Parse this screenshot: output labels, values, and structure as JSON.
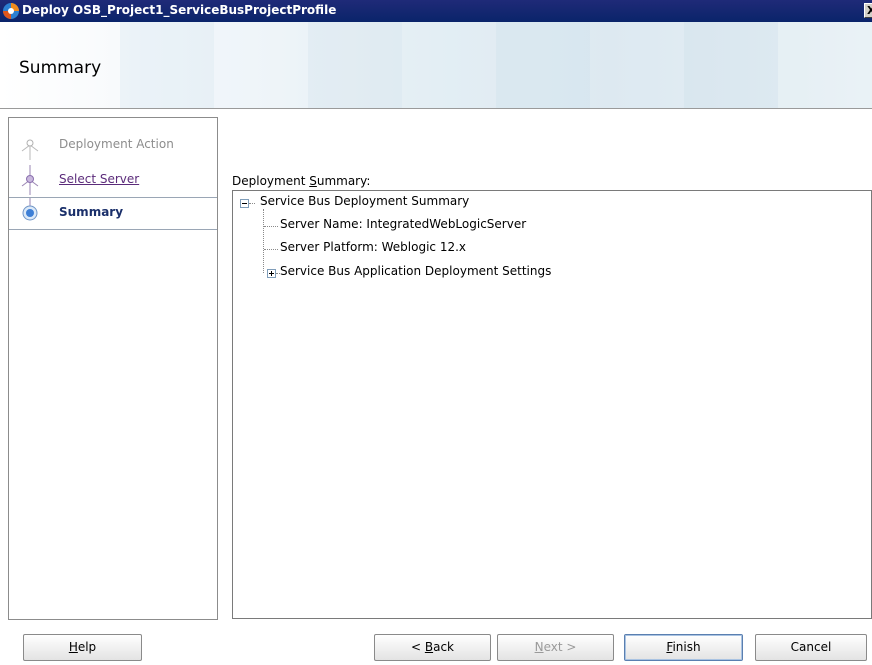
{
  "window": {
    "title": "Deploy OSB_Project1_ServiceBusProjectProfile",
    "close_glyph": "X"
  },
  "header": {
    "title": "Summary"
  },
  "sidebar": {
    "items": [
      {
        "label": "Deployment Action",
        "state": "disabled",
        "icon": "step-node-icon"
      },
      {
        "label": "Select Server",
        "state": "link",
        "icon": "step-node-icon"
      },
      {
        "label": "Summary",
        "state": "current",
        "icon": "current-step-icon"
      }
    ]
  },
  "main": {
    "summary_label_prefix": "Deployment ",
    "summary_label_mnemonic": "S",
    "summary_label_suffix": "ummary:",
    "tree": {
      "root": "Service Bus Deployment Summary",
      "children": [
        "Server Name: IntegratedWebLogicServer",
        "Server Platform: Weblogic 12.x",
        "Service Bus Application Deployment Settings"
      ]
    }
  },
  "buttons": {
    "help": {
      "mnemonic": "H",
      "rest": "elp"
    },
    "back": {
      "prefix": "< ",
      "mnemonic": "B",
      "rest": "ack"
    },
    "next": {
      "mnemonic": "N",
      "rest": "ext >"
    },
    "finish": {
      "mnemonic": "F",
      "rest": "inish"
    },
    "cancel": {
      "label": "Cancel"
    }
  },
  "colors": {
    "titlebar": "#0a246a",
    "link": "#5b2b7a",
    "current_step": "#1a2f6a",
    "disabled_text": "#8d8d8d"
  }
}
